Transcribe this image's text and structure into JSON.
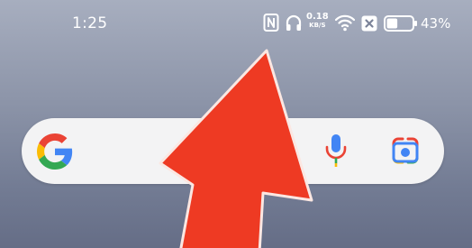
{
  "status_bar": {
    "time": "1:25",
    "icons": [
      "nfc-icon",
      "headphones-icon",
      "wifi-icon",
      "sim-icon",
      "battery-icon"
    ],
    "net_speed_value": "0.18",
    "net_speed_unit": "KB/S",
    "battery_percent": "43%",
    "battery_level": 0.43
  },
  "search_widget": {
    "logo": "google-g-icon",
    "mic": "mic-icon",
    "lens": "google-lens-icon"
  },
  "overlay": {
    "arrow_icon": "swipe-up-arrow-icon",
    "arrow_color": "#ee3a23"
  },
  "colors": {
    "google_blue": "#4285f4",
    "google_red": "#ea4335",
    "google_yellow": "#fbbc05",
    "google_green": "#34a853"
  }
}
